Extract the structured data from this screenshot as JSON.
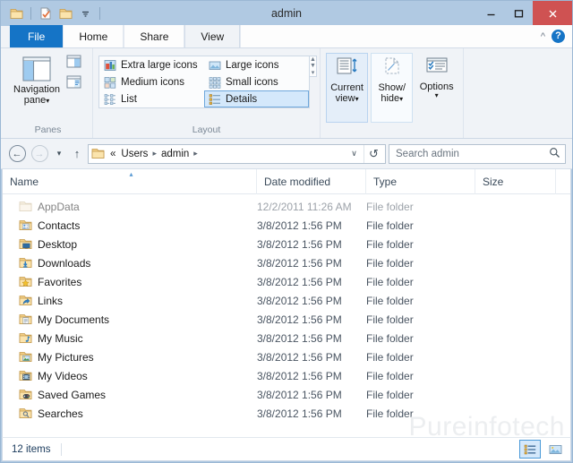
{
  "window": {
    "title": "admin",
    "quick_access": [
      {
        "name": "folder-icon",
        "label": "Folder"
      },
      {
        "name": "properties-icon",
        "label": "Properties"
      },
      {
        "name": "new-folder-icon",
        "label": "New folder"
      },
      {
        "name": "chevron-down-icon",
        "label": "Customize Quick Access Toolbar"
      }
    ],
    "controls": {
      "minimize": "Minimize",
      "maximize": "Maximize",
      "close": "Close"
    }
  },
  "tabs": [
    {
      "label": "File",
      "state": "file"
    },
    {
      "label": "Home",
      "state": "normal"
    },
    {
      "label": "Share",
      "state": "normal"
    },
    {
      "label": "View",
      "state": "active"
    }
  ],
  "tab_right": {
    "collapse_label": "^",
    "help_label": "?"
  },
  "ribbon": {
    "groups": [
      {
        "label": "Panes",
        "navigation_pane": {
          "line1": "Navigation",
          "line2": "pane",
          "caret": "▾"
        },
        "small_buttons": [
          {
            "name": "preview-pane-icon",
            "label": "Preview pane"
          },
          {
            "name": "details-pane-icon",
            "label": "Details pane"
          }
        ]
      },
      {
        "label": "Layout",
        "gallery": [
          {
            "label": "Extra large icons",
            "selected": false
          },
          {
            "label": "Large icons",
            "selected": false
          },
          {
            "label": "Medium icons",
            "selected": false
          },
          {
            "label": "Small icons",
            "selected": false
          },
          {
            "label": "List",
            "selected": false
          },
          {
            "label": "Details",
            "selected": true
          }
        ],
        "scroll": [
          "▲",
          "▼",
          "▾"
        ]
      },
      {
        "label": "",
        "buttons": [
          {
            "line1": "Current",
            "line2": "view",
            "caret": "▾",
            "selected": true
          },
          {
            "line1": "Show/",
            "line2": "hide",
            "caret": "▾",
            "selected": false
          },
          {
            "line1": "Options",
            "line2": "",
            "caret": "▾",
            "selected": false
          }
        ]
      }
    ]
  },
  "address_bar": {
    "back": "←",
    "forward": "→",
    "history_caret": "▾",
    "up": "↑",
    "breadcrumbs": [
      "«",
      "Users",
      "admin"
    ],
    "separator": "▸",
    "dropdown_caret": "∨",
    "refresh": "↺"
  },
  "search": {
    "placeholder": "Search admin",
    "icon": "search-icon"
  },
  "columns": [
    {
      "label": "Name",
      "sorted": true,
      "sort_dir": "▴"
    },
    {
      "label": "Date modified",
      "sorted": false,
      "sort_dir": ""
    },
    {
      "label": "Type",
      "sorted": false,
      "sort_dir": ""
    },
    {
      "label": "Size",
      "sorted": false,
      "sort_dir": ""
    }
  ],
  "files": [
    {
      "name": "AppData",
      "date": "12/2/2011 11:26 AM",
      "type": "File folder",
      "size": "",
      "icon": "folder-plain-icon",
      "faded": true
    },
    {
      "name": "Contacts",
      "date": "3/8/2012 1:56 PM",
      "type": "File folder",
      "size": "",
      "icon": "folder-contacts-icon",
      "faded": false
    },
    {
      "name": "Desktop",
      "date": "3/8/2012 1:56 PM",
      "type": "File folder",
      "size": "",
      "icon": "folder-desktop-icon",
      "faded": false
    },
    {
      "name": "Downloads",
      "date": "3/8/2012 1:56 PM",
      "type": "File folder",
      "size": "",
      "icon": "folder-downloads-icon",
      "faded": false
    },
    {
      "name": "Favorites",
      "date": "3/8/2012 1:56 PM",
      "type": "File folder",
      "size": "",
      "icon": "folder-favorites-icon",
      "faded": false
    },
    {
      "name": "Links",
      "date": "3/8/2012 1:56 PM",
      "type": "File folder",
      "size": "",
      "icon": "folder-links-icon",
      "faded": false
    },
    {
      "name": "My Documents",
      "date": "3/8/2012 1:56 PM",
      "type": "File folder",
      "size": "",
      "icon": "folder-documents-icon",
      "faded": false
    },
    {
      "name": "My Music",
      "date": "3/8/2012 1:56 PM",
      "type": "File folder",
      "size": "",
      "icon": "folder-music-icon",
      "faded": false
    },
    {
      "name": "My Pictures",
      "date": "3/8/2012 1:56 PM",
      "type": "File folder",
      "size": "",
      "icon": "folder-pictures-icon",
      "faded": false
    },
    {
      "name": "My Videos",
      "date": "3/8/2012 1:56 PM",
      "type": "File folder",
      "size": "",
      "icon": "folder-videos-icon",
      "faded": false
    },
    {
      "name": "Saved Games",
      "date": "3/8/2012 1:56 PM",
      "type": "File folder",
      "size": "",
      "icon": "folder-games-icon",
      "faded": false
    },
    {
      "name": "Searches",
      "date": "3/8/2012 1:56 PM",
      "type": "File folder",
      "size": "",
      "icon": "folder-searches-icon",
      "faded": false
    }
  ],
  "status_bar": {
    "item_count": "12 items",
    "view_toggles": [
      {
        "name": "details-view-icon",
        "label": "Details view",
        "selected": true
      },
      {
        "name": "large-icons-view-icon",
        "label": "Large icons view",
        "selected": false
      }
    ]
  },
  "watermark": "Pureinfotech",
  "colors": {
    "title_bar": "#b0c9e2",
    "accent_blue": "#1574c6",
    "close_red": "#cf5252",
    "selection_blue": "#d4e8fb",
    "folder_yellow": "#f6d488"
  }
}
